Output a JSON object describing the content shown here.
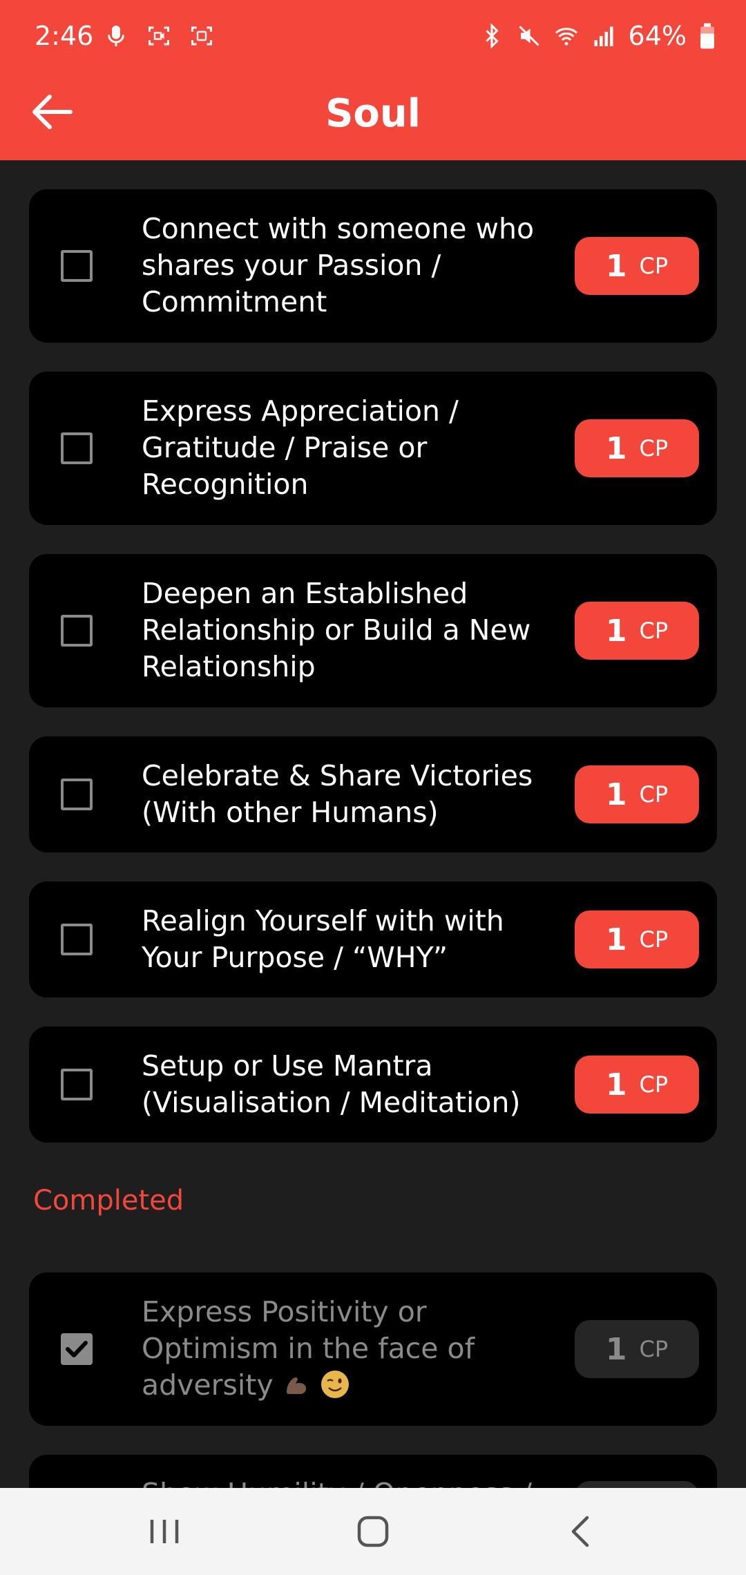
{
  "status_bar": {
    "time": "2:46",
    "battery": "64%",
    "left_icons": [
      "microphone-icon",
      "screen-record-icon",
      "screenshot-icon"
    ],
    "right_icons": [
      "bluetooth-icon",
      "mute-icon",
      "wifi-icon",
      "signal-icon",
      "battery-icon"
    ]
  },
  "header": {
    "title": "Soul",
    "back_icon": "arrow-left-icon"
  },
  "colors": {
    "accent": "#f4473b",
    "background": "#1e1e1e",
    "card": "#000000",
    "muted": "#8a8a8a"
  },
  "tasks": [
    {
      "label": "Connect with someone who shares your Passion / Commitment",
      "points": "1",
      "unit": "CP",
      "checked": false
    },
    {
      "label": "Express Appreciation / Gratitude / Praise or Recognition",
      "points": "1",
      "unit": "CP",
      "checked": false
    },
    {
      "label": "Deepen an Established Relationship or Build a New Relationship",
      "points": "1",
      "unit": "CP",
      "checked": false
    },
    {
      "label": "Celebrate & Share Victories (With other Humans)",
      "points": "1",
      "unit": "CP",
      "checked": false
    },
    {
      "label": "Realign Yourself with with Your Purpose / “WHY”",
      "points": "1",
      "unit": "CP",
      "checked": false
    },
    {
      "label": "Setup or Use Mantra (Visualisation / Meditation)",
      "points": "1",
      "unit": "CP",
      "checked": false
    }
  ],
  "completed": {
    "heading": "Completed",
    "items": [
      {
        "label": "Express Positivity or Optimism in the face of adversity",
        "points": "1",
        "unit": "CP",
        "checked": true,
        "emojis": [
          "flexed-biceps-emoji",
          "winking-face-emoji"
        ]
      },
      {
        "label": "Show Humility / Openness /",
        "checked": true
      }
    ]
  },
  "nav_bar": {
    "buttons": [
      "recent-apps-icon",
      "home-icon",
      "back-icon"
    ]
  }
}
